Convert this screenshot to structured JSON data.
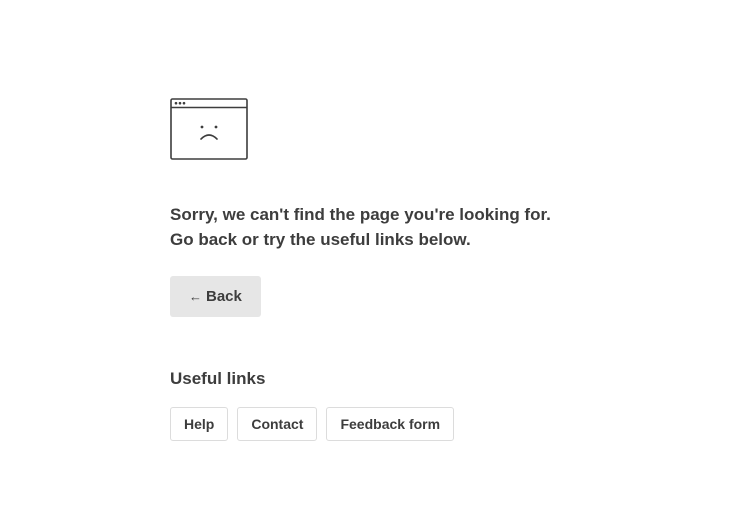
{
  "illustration": {
    "icon": "sad-browser-window-icon",
    "stroke_color": "#3d3d3d"
  },
  "message": {
    "line1": "Sorry, we can't find the page you're looking for.",
    "line2": "Go back or try the useful links below."
  },
  "back_button": {
    "arrow_icon": "←",
    "label": "Back"
  },
  "useful_links": {
    "heading": "Useful links",
    "links": [
      {
        "label": "Help"
      },
      {
        "label": "Contact"
      },
      {
        "label": "Feedback form"
      }
    ]
  },
  "colors": {
    "text": "#3d3d3d",
    "button_bg": "#e6e6e6",
    "link_border": "#dcdcdc"
  }
}
